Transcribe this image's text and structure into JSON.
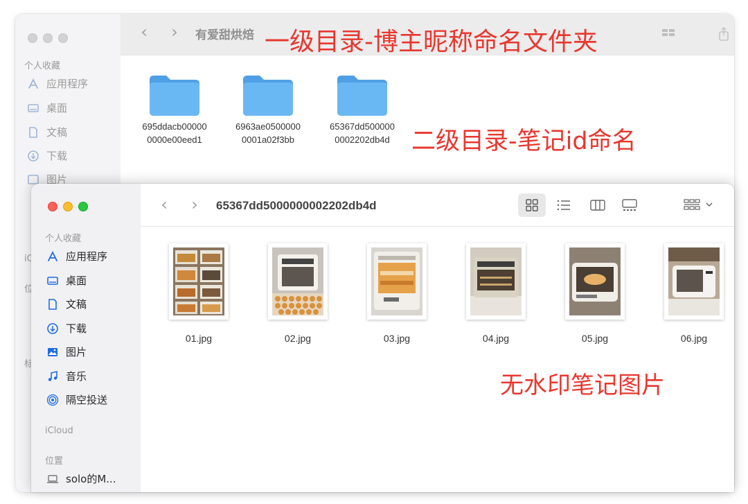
{
  "annotations": {
    "level1": "一级目录-博主昵称命名文件夹",
    "level2": "二级目录-笔记id命名",
    "images": "无水印笔记图片"
  },
  "back_window": {
    "title": "有爱甜烘焙",
    "sidebar": {
      "section_favorites": "个人收藏",
      "items": [
        {
          "label": "应用程序",
          "icon": "apps-icon"
        },
        {
          "label": "桌面",
          "icon": "desktop-icon"
        },
        {
          "label": "文稿",
          "icon": "document-icon"
        },
        {
          "label": "下载",
          "icon": "download-icon"
        },
        {
          "label": "图片",
          "icon": "pictures-icon"
        }
      ],
      "partial_icloud": "iC",
      "partial_locations": "位",
      "partial_tags": "标"
    },
    "folders": [
      {
        "line1": "695ddacb00000",
        "line2": "0000e00eed1"
      },
      {
        "line1": "6963ae0500000",
        "line2": "0001a02f3bb"
      },
      {
        "line1": "65367dd500000",
        "line2": "0002202db4d"
      }
    ]
  },
  "front_window": {
    "title": "65367dd5000000002202db4d",
    "sidebar": {
      "section_favorites": "个人收藏",
      "items": [
        {
          "label": "应用程序",
          "icon": "apps-icon"
        },
        {
          "label": "桌面",
          "icon": "desktop-icon"
        },
        {
          "label": "文稿",
          "icon": "document-icon"
        },
        {
          "label": "下载",
          "icon": "download-icon"
        },
        {
          "label": "图片",
          "icon": "pictures-icon"
        },
        {
          "label": "音乐",
          "icon": "music-icon"
        },
        {
          "label": "隔空投送",
          "icon": "airdrop-icon"
        }
      ],
      "section_icloud": "iCloud",
      "section_locations": "位置",
      "location_item": "solo的M..."
    },
    "files": [
      {
        "name": "01.jpg"
      },
      {
        "name": "02.jpg"
      },
      {
        "name": "03.jpg"
      },
      {
        "name": "04.jpg"
      },
      {
        "name": "05.jpg"
      },
      {
        "name": "06.jpg"
      }
    ]
  },
  "colors": {
    "accent": "#1d6ce0",
    "annotation": "#e8372f",
    "folder": "#5aaef0"
  }
}
